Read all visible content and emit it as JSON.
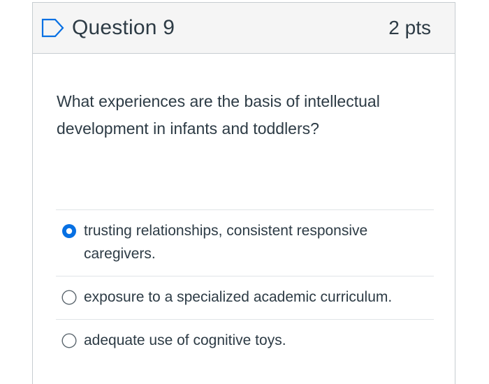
{
  "question": {
    "title": "Question 9",
    "points": "2 pts",
    "text": "What experiences are the basis of intellectual development in infants and toddlers?"
  },
  "answers": [
    {
      "label": "trusting relationships, consistent responsive caregivers.",
      "selected": true
    },
    {
      "label": "exposure to a specialized academic curriculum.",
      "selected": false
    },
    {
      "label": "adequate use of cognitive toys.",
      "selected": false
    }
  ],
  "colors": {
    "accent": "#0770e3",
    "text": "#2d3b45",
    "header_bg": "#f5f5f5",
    "border": "#c7cdd1"
  },
  "icons": {
    "flag": "flag-outline-icon"
  }
}
